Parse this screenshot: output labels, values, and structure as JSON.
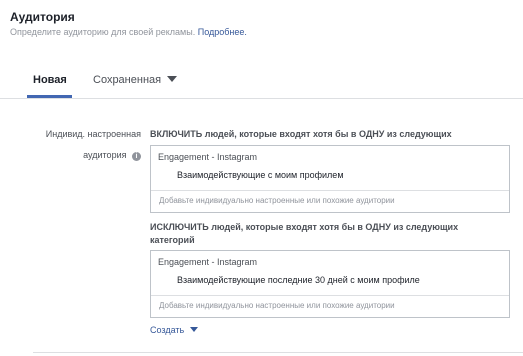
{
  "section": {
    "title": "Аудитория",
    "subtitle": "Определите аудиторию для своей рекламы.",
    "more_link": "Подробнее."
  },
  "tabs": [
    {
      "label": "Новая",
      "active": true
    },
    {
      "label": "Сохраненная",
      "active": false
    }
  ],
  "custom_audience": {
    "label_line1": "Индивид. настроенная",
    "label_line2": "аудитория",
    "include": {
      "heading": "ВКЛЮЧИТЬ людей, которые входят хотя бы в ОДНУ из следующих",
      "category": "Engagement - Instagram",
      "item": "Взаимодействующие с моим профилем",
      "placeholder": "Добавьте индивидуально настроенные или похожие аудитории"
    },
    "exclude": {
      "heading_line1": "ИСКЛЮЧИТЬ людей, которые входят хотя бы в ОДНУ из следующих",
      "heading_line2": "категорий",
      "category": "Engagement - Instagram",
      "item": "Взаимодействующие последние 30 дней с моим профиле",
      "placeholder": "Добавьте индивидуально настроенные или похожие аудитории"
    },
    "create_label": "Создать"
  },
  "colors": {
    "accent": "#4267b2",
    "link": "#365899"
  },
  "icons": {
    "info": "info-icon",
    "dropdown": "caret-down-icon"
  }
}
